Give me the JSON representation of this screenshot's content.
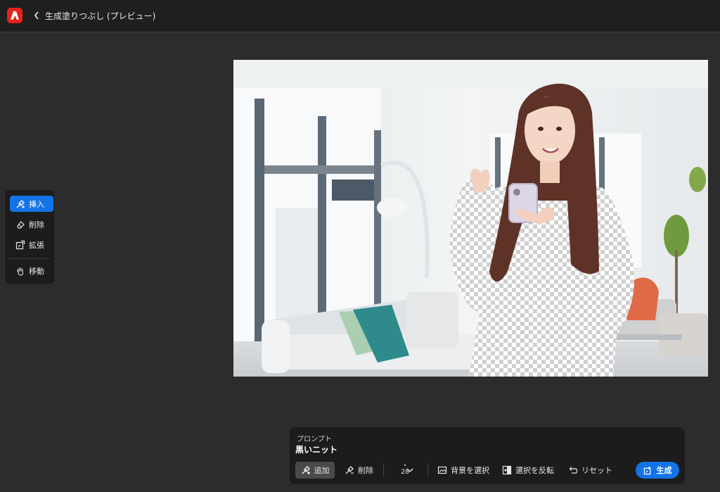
{
  "header": {
    "title": "生成塗りつぶし (プレビュー)"
  },
  "toolbar": {
    "items": [
      {
        "label": "挿入",
        "icon": "brush-plus-icon",
        "active": true
      },
      {
        "label": "削除",
        "icon": "eraser-icon",
        "active": false
      },
      {
        "label": "拡張",
        "icon": "expand-icon",
        "active": false
      },
      {
        "label": "移動",
        "icon": "hand-icon",
        "active": false
      }
    ]
  },
  "prompt": {
    "label": "プロンプト",
    "value": "黒いニット",
    "add_label": "追加",
    "delete_label": "削除",
    "brush_size": "28",
    "select_background_label": "背景を選択",
    "invert_selection_label": "選択を反転",
    "reset_label": "リセット",
    "generate_label": "生成"
  },
  "colors": {
    "accent": "#1473e6",
    "brand": "#e8201a"
  }
}
